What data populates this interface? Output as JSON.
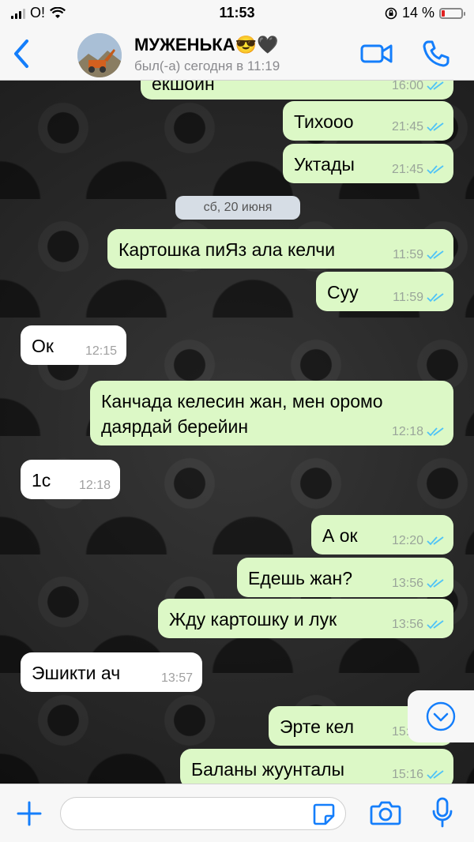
{
  "status_bar": {
    "carrier": "O!",
    "time": "11:53",
    "battery_percent": "14 %"
  },
  "header": {
    "contact_name": "МУЖЕНЬКА😎🖤",
    "contact_status": "был(-а) сегодня в 11:19"
  },
  "chat": {
    "date_separator": "сб, 20 июня",
    "messages": [
      {
        "direction": "out",
        "text": "екшоин",
        "time": "16:00"
      },
      {
        "direction": "out",
        "text": "Тихооо",
        "time": "21:45"
      },
      {
        "direction": "out",
        "text": "Уктады",
        "time": "21:45"
      },
      {
        "direction": "out",
        "text": "Картошка пиЯз ала келчи",
        "time": "11:59"
      },
      {
        "direction": "out",
        "text": "Суу",
        "time": "11:59"
      },
      {
        "direction": "in",
        "text": "Ок",
        "time": "12:15"
      },
      {
        "direction": "out",
        "text": "Канчада келесин жан, мен оромо даярдай берейин",
        "time": "12:18"
      },
      {
        "direction": "in",
        "text": "1с",
        "time": "12:18"
      },
      {
        "direction": "out",
        "text": "А ок",
        "time": "12:20"
      },
      {
        "direction": "out",
        "text": "Едешь жан?",
        "time": "13:56"
      },
      {
        "direction": "out",
        "text": "Жду картошку и лук",
        "time": "13:56"
      },
      {
        "direction": "in",
        "text": "Эшикти ач",
        "time": "13:57"
      },
      {
        "direction": "out",
        "text": "Эрте кел",
        "time": "15:16"
      },
      {
        "direction": "out",
        "text": "Баланы жуунталы",
        "time": "15:16"
      }
    ]
  },
  "input_bar": {
    "placeholder": ""
  },
  "colors": {
    "accent": "#147efb",
    "outgoing_bubble": "#dcf8c6",
    "incoming_bubble": "#ffffff",
    "read_ticks": "#4fc3f7"
  }
}
